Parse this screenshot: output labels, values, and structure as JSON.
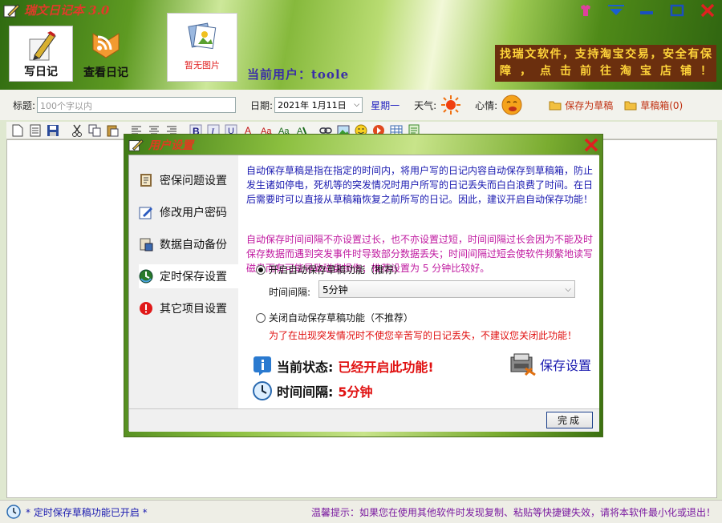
{
  "app": {
    "title": "瑞文日记本 3.0"
  },
  "header": {
    "write_label": "写日记",
    "view_label": "查看日记",
    "photo_caption": "暂无图片",
    "current_user": "当前用户：toole",
    "taobao_text": "找瑞文软件，支持淘宝交易，安全有保障，点击前往淘宝店铺！"
  },
  "form": {
    "title_label": "标题:",
    "title_placeholder": "100个字以内",
    "date_label": "日期:",
    "date_value": "2021年 1月11日",
    "weekday": "星期一",
    "weather_label": "天气:",
    "mood_label": "心情:",
    "save_draft": "保存为草稿",
    "draft_box": "草稿箱(0)"
  },
  "dialog": {
    "title": "用户设置",
    "nav": [
      {
        "label": "密保问题设置"
      },
      {
        "label": "修改用户密码"
      },
      {
        "label": "数据自动备份"
      },
      {
        "label": "定时保存设置"
      },
      {
        "label": "其它项目设置"
      }
    ],
    "desc_blue": "自动保存草稿是指在指定的时间内，将用户写的日记内容自动保存到草稿箱，防止发生诸如停电，死机等的突发情况时用户所写的日记丢失而白白浪费了时间。在日后需要时可以直接从草稿箱恢复之前所写的日记。因此，建议开启自动保存功能！",
    "desc_magenta": "自动保存时间间隔不亦设置过长，也不亦设置过短，时间间隔过长会因为不能及时保存数据而遇到突发事件时导致部分数据丢失；时间间隔过短会使软件频繁地读写磁盘而有可能导致磁盘损伤；推荐设置为 5 分钟比较好。",
    "radio_on": "开启自动保存草稿功能（推荐）",
    "interval_label": "时间间隔:",
    "interval_value": "5分钟",
    "radio_off": "关闭自动保存草稿功能（不推荐）",
    "warning": "为了在出现突发情况时不使您辛苦写的日记丢失，不建议您关闭此功能！",
    "state_label": "当前状态:",
    "state_value": "已经开启此功能!",
    "interval_state_label": "时间间隔:",
    "interval_state_value": "5分钟",
    "save_settings": "保存设置",
    "done": "完成"
  },
  "status": {
    "left": "* 定时保存草稿功能已开启 *",
    "right": "温馨提示：如果您在使用其他软件时发现复制、粘贴等快捷键失效，请将本软件最小化或退出！"
  },
  "colors": {
    "accent_red": "#e01010",
    "link_blue": "#1a1ab0",
    "taobao_bg": "#6b2f0e",
    "taobao_text": "#ffd43a"
  }
}
